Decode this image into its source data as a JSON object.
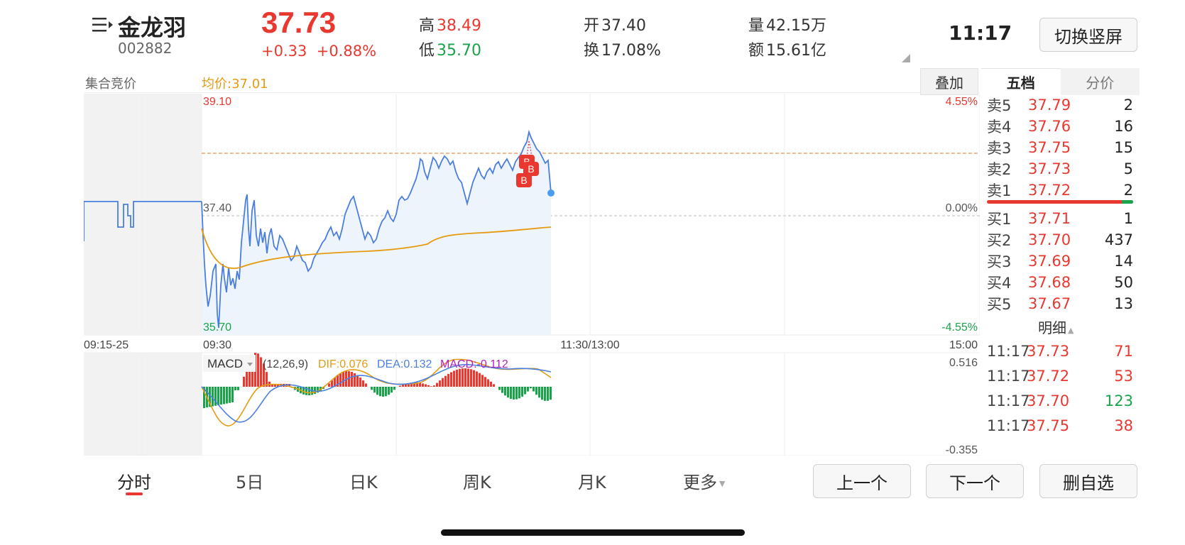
{
  "header": {
    "name": "金龙羽",
    "code": "002882",
    "price": "37.73",
    "change": "+0.33",
    "change_pct": "+0.88%",
    "high_label": "高",
    "high": "38.49",
    "low_label": "低",
    "low": "35.70",
    "open_label": "开",
    "open": "37.40",
    "turnover_label": "换",
    "turnover": "17.08%",
    "volume_label": "量",
    "volume": "42.15万",
    "amount_label": "额",
    "amount": "15.61亿",
    "time": "11:17",
    "switch_label": "切换竖屏"
  },
  "chart": {
    "auction_label": "集合竞价",
    "avg_label": "均价:37.01",
    "overlay_label": "叠加",
    "y_high": "39.10",
    "y_mid": "37.40",
    "y_low": "35.70",
    "pct_high": "4.55%",
    "pct_mid": "0.00%",
    "pct_low": "-4.55%",
    "time_labels": [
      "09:15-25",
      "09:30",
      "11:30/13:00",
      "15:00"
    ],
    "markers": [
      "B",
      "B",
      "B"
    ]
  },
  "macd": {
    "selector": "MACD",
    "params": "(12,26,9)",
    "dif": "DIF:0.076",
    "dea": "DEA:0.132",
    "macd": "MACD:-0.112",
    "y_high": "0.516",
    "y_low": "-0.355"
  },
  "orderbook": {
    "tab_active": "五档",
    "tab_inactive": "分价",
    "asks": [
      {
        "label": "卖5",
        "price": "37.79",
        "qty": "2"
      },
      {
        "label": "卖4",
        "price": "37.76",
        "qty": "16"
      },
      {
        "label": "卖3",
        "price": "37.75",
        "qty": "15"
      },
      {
        "label": "卖2",
        "price": "37.73",
        "qty": "5"
      },
      {
        "label": "卖1",
        "price": "37.72",
        "qty": "2"
      }
    ],
    "bids": [
      {
        "label": "买1",
        "price": "37.71",
        "qty": "1"
      },
      {
        "label": "买2",
        "price": "37.70",
        "qty": "437"
      },
      {
        "label": "买3",
        "price": "37.69",
        "qty": "14"
      },
      {
        "label": "买4",
        "price": "37.68",
        "qty": "50"
      },
      {
        "label": "买5",
        "price": "37.67",
        "qty": "13"
      }
    ],
    "detail_label": "明细",
    "ticks": [
      {
        "time": "11:17",
        "price": "37.73",
        "qty": "71",
        "color": "#e8382f"
      },
      {
        "time": "11:17",
        "price": "37.72",
        "qty": "53",
        "color": "#e8382f"
      },
      {
        "time": "11:17",
        "price": "37.70",
        "qty": "123",
        "color": "#1aa34a"
      },
      {
        "time": "11:17",
        "price": "37.75",
        "qty": "38",
        "color": "#e8382f"
      }
    ]
  },
  "bottom": {
    "tabs": [
      "分时",
      "5日",
      "日K",
      "周K",
      "月K",
      "更多"
    ],
    "prev": "上一个",
    "next": "下一个",
    "remove": "删自选"
  },
  "colors": {
    "up": "#e8382f",
    "down": "#1aa34a",
    "price_line": "#4a7fe0",
    "avg_line": "#e69a10"
  }
}
